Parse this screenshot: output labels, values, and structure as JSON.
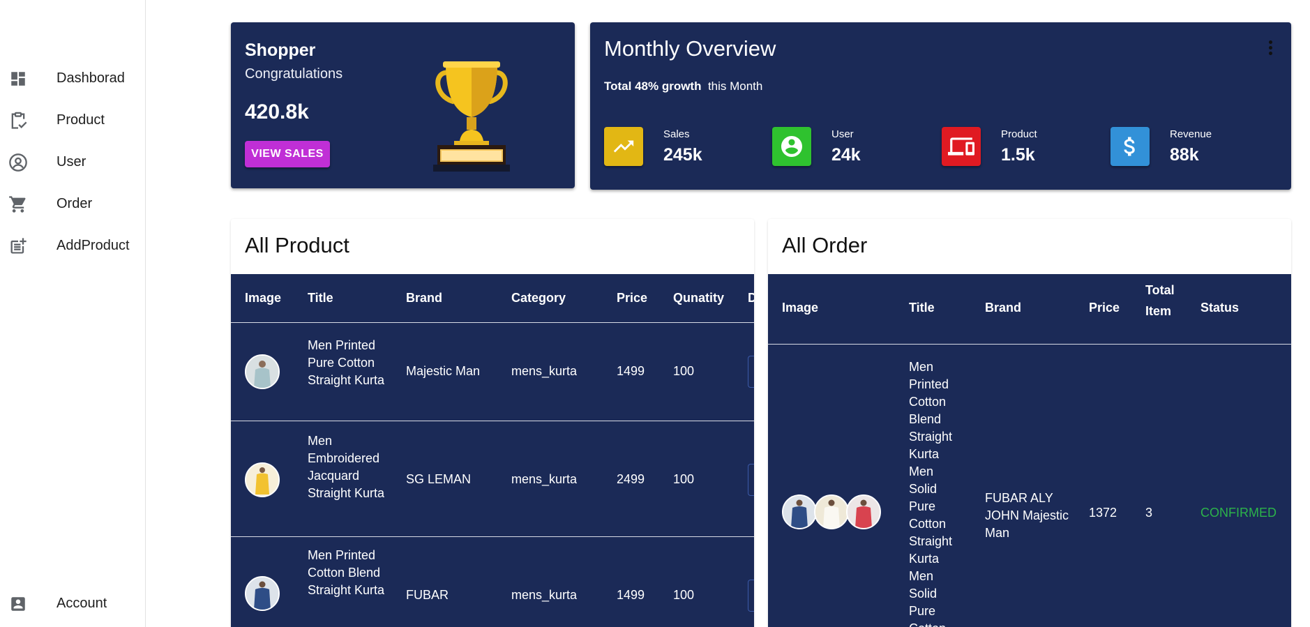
{
  "sidebar": {
    "items": [
      {
        "label": "Dashborad",
        "icon": "dashboard-icon"
      },
      {
        "label": "Product",
        "icon": "clipboard-check-icon"
      },
      {
        "label": "User",
        "icon": "account-circle-icon"
      },
      {
        "label": "Order",
        "icon": "cart-icon"
      },
      {
        "label": "AddProduct",
        "icon": "post-add-icon"
      }
    ],
    "account": {
      "label": "Account",
      "icon": "account-box-icon"
    }
  },
  "shopper": {
    "title": "Shopper",
    "subtitle": "Congratulations",
    "value": "420.8k",
    "button": "VIEW SALES"
  },
  "overview": {
    "title": "Monthly Overview",
    "growth_bold": "Total 48% growth",
    "growth_rest": "this Month",
    "stats": [
      {
        "label": "Sales",
        "value": "245k",
        "color": "#e2b714",
        "icon": "trending-up-icon"
      },
      {
        "label": "User",
        "value": "24k",
        "color": "#2fc22f",
        "icon": "account-circle-icon"
      },
      {
        "label": "Product",
        "value": "1.5k",
        "color": "#e01a22",
        "icon": "devices-icon"
      },
      {
        "label": "Revenue",
        "value": "88k",
        "color": "#3291d8",
        "icon": "dollar-icon"
      }
    ]
  },
  "products": {
    "title": "All Product",
    "columns": [
      "Image",
      "Title",
      "Brand",
      "Category",
      "Price",
      "Qunatity",
      "D"
    ],
    "rows": [
      {
        "title": "Men Printed Pure Cotton Straight Kurta",
        "brand": "Majestic Man",
        "category": "mens_kurta",
        "price": "1499",
        "quantity": "100"
      },
      {
        "title": "Men Embroidered Jacquard Straight Kurta",
        "brand": "SG LEMAN",
        "category": "mens_kurta",
        "price": "2499",
        "quantity": "100"
      },
      {
        "title": "Men Printed Cotton Blend Straight Kurta",
        "brand": "FUBAR",
        "category": "mens_kurta",
        "price": "1499",
        "quantity": "100"
      }
    ]
  },
  "orders": {
    "title": "All Order",
    "columns": [
      "Image",
      "Title",
      "Brand",
      "Price",
      "Total Item",
      "Status"
    ],
    "rows": [
      {
        "title": "Men Printed Cotton Blend Straight Kurta Men Solid Pure Cotton Straight Kurta Men Solid Pure Cotton",
        "brand": "FUBAR ALY JOHN Majestic Man",
        "price": "1372",
        "total_item": "3",
        "status": "CONFIRMED"
      }
    ]
  },
  "colors": {
    "card_bg": "#1b2a57",
    "view_sales_button": "#c02fd6",
    "confirmed": "#2cb34a"
  }
}
